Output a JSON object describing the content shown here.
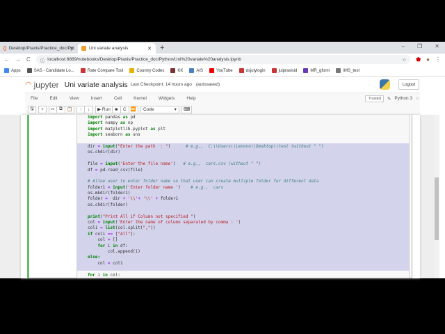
{
  "browser": {
    "tabs": [
      {
        "label": "Desktop/Praxis/Practice_doc/Pyt",
        "active": false
      },
      {
        "label": "Uni variate analysis",
        "active": true
      }
    ],
    "url": "localhost:8889/notebooks/Desktop/Praxis/Practice_doc/Python/Uni%20variate%20analysis.ipynb",
    "bookmarks": [
      {
        "label": "Apps",
        "color": "#4285f4"
      },
      {
        "label": "SAS - Candidate Lo...",
        "color": "#555"
      },
      {
        "label": "Rate Compare Tool",
        "color": "#c33"
      },
      {
        "label": "Country Codes",
        "color": "#e8b000"
      },
      {
        "label": "KK",
        "color": "#733"
      },
      {
        "label": "AIS",
        "color": "#4a7fc1"
      },
      {
        "label": "YouTube",
        "color": "#e00"
      },
      {
        "label": "dsjulylogin",
        "color": "#c33"
      },
      {
        "label": "juipraxisid",
        "color": "#c33"
      },
      {
        "label": "MR_gform",
        "color": "#673ab7"
      },
      {
        "label": "IMS_test",
        "color": "#777"
      }
    ]
  },
  "jupyter": {
    "logo": "jupyter",
    "notebook_name": "Uni variate analysis",
    "checkpoint": "Last Checkpoint: 14 hours ago",
    "autosave": "(autosaved)",
    "logout": "Logout",
    "menu": [
      "File",
      "Edit",
      "View",
      "Insert",
      "Cell",
      "Kernel",
      "Widgets",
      "Help"
    ],
    "trusted": "Trusted",
    "kernel": "Python 3",
    "run_label": "Run",
    "cell_type": "Code"
  },
  "code_lines": [
    "import pandas as pd",
    "import numpy as np",
    "import matplotlib.pyplot as plt",
    "import seaborn as sns",
    "",
    "dir = input(\"Enter the path  : \")      # e.g.,  C:\\\\Users\\\\Lenovo\\\\Desktop\\\\test (without \" \")",
    "os.chdir(dir)",
    "",
    "file = input('Enter the file name')   # e.g.,  cars.csv (without \" \")",
    "df = pd.read_csv(file)",
    "",
    "# Allow user to enter folder name so that user can create multiple folder for different data",
    "folder1 = input('Enter folder name ')    # e.g.,  cars",
    "os.mkdir(folder1)",
    "folder =  dir + '\\\\'+ '\\\\' + folder1",
    "os.chdir(folder)",
    "",
    "print(\"Print All if Column not specified \")",
    "col = input('Enter the name of column separated by comma : ')",
    "col1 = list(col.split(\",\"))",
    "if col1 == [\"All\"]:",
    "    col = []",
    "    for i in df:",
    "        col.append(i)",
    "else:",
    "    col = col1",
    "",
    "for i in col:"
  ]
}
